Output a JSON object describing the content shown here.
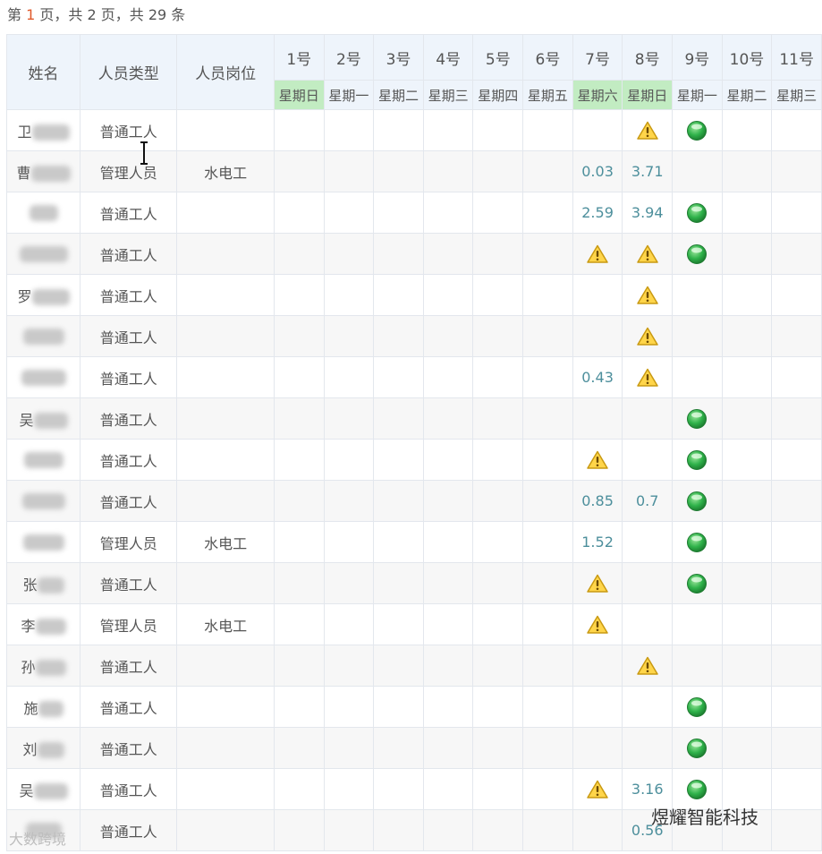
{
  "pager": {
    "prefix": "第 ",
    "current": "1",
    "middle": " 页，共 ",
    "total_pages": "2",
    "suffix1": " 页，共 ",
    "total_records": "29",
    "suffix2": " 条"
  },
  "columns": {
    "name": "姓名",
    "type": "人员类型",
    "post": "人员岗位"
  },
  "days": [
    {
      "num": "1号",
      "week": "星期日",
      "weekend": true
    },
    {
      "num": "2号",
      "week": "星期一",
      "weekend": false
    },
    {
      "num": "3号",
      "week": "星期二",
      "weekend": false
    },
    {
      "num": "4号",
      "week": "星期三",
      "weekend": false
    },
    {
      "num": "5号",
      "week": "星期四",
      "weekend": false
    },
    {
      "num": "6号",
      "week": "星期五",
      "weekend": false
    },
    {
      "num": "7号",
      "week": "星期六",
      "weekend": true
    },
    {
      "num": "8号",
      "week": "星期日",
      "weekend": true
    },
    {
      "num": "9号",
      "week": "星期一",
      "weekend": false
    },
    {
      "num": "10号",
      "week": "星期二",
      "weekend": false
    },
    {
      "num": "11号",
      "week": "星期三",
      "weekend": false
    }
  ],
  "icons": {
    "warn": "warning-icon",
    "ok": "green-dot-icon"
  },
  "rows": [
    {
      "name": "卫",
      "type": "普通工人",
      "post": "",
      "cells": {
        "8": "warn",
        "9": "ok"
      }
    },
    {
      "name": "曹",
      "type": "管理人员",
      "post": "水电工",
      "cells": {
        "7": "0.03",
        "8": "3.71"
      }
    },
    {
      "name": "",
      "type": "普通工人",
      "post": "",
      "cells": {
        "7": "2.59",
        "8": "3.94",
        "9": "ok"
      }
    },
    {
      "name": "",
      "type": "普通工人",
      "post": "",
      "cells": {
        "7": "warn",
        "8": "warn",
        "9": "ok"
      }
    },
    {
      "name": "罗",
      "type": "普通工人",
      "post": "",
      "cells": {
        "8": "warn"
      }
    },
    {
      "name": "",
      "type": "普通工人",
      "post": "",
      "cells": {
        "8": "warn"
      }
    },
    {
      "name": "",
      "type": "普通工人",
      "post": "",
      "cells": {
        "7": "0.43",
        "8": "warn"
      }
    },
    {
      "name": "吴",
      "type": "普通工人",
      "post": "",
      "cells": {
        "9": "ok"
      }
    },
    {
      "name": "",
      "type": "普通工人",
      "post": "",
      "cells": {
        "7": "warn",
        "9": "ok"
      }
    },
    {
      "name": "",
      "type": "普通工人",
      "post": "",
      "cells": {
        "7": "0.85",
        "8": "0.7",
        "9": "ok"
      }
    },
    {
      "name": "",
      "type": "管理人员",
      "post": "水电工",
      "cells": {
        "7": "1.52",
        "9": "ok"
      }
    },
    {
      "name": "张",
      "type": "普通工人",
      "post": "",
      "cells": {
        "7": "warn",
        "9": "ok"
      }
    },
    {
      "name": "李",
      "type": "管理人员",
      "post": "水电工",
      "cells": {
        "7": "warn"
      }
    },
    {
      "name": "孙",
      "type": "普通工人",
      "post": "",
      "cells": {
        "8": "warn"
      }
    },
    {
      "name": "施",
      "type": "普通工人",
      "post": "",
      "cells": {
        "9": "ok"
      }
    },
    {
      "name": "刘",
      "type": "普通工人",
      "post": "",
      "cells": {
        "9": "ok"
      }
    },
    {
      "name": "吴",
      "type": "普通工人",
      "post": "",
      "cells": {
        "7": "warn",
        "8": "3.16",
        "9": "ok"
      }
    },
    {
      "name": "",
      "type": "普通工人",
      "post": "",
      "cells": {
        "8": "0.56"
      }
    }
  ],
  "watermark": "煜耀智能科技",
  "watermark2": "大数跨境"
}
